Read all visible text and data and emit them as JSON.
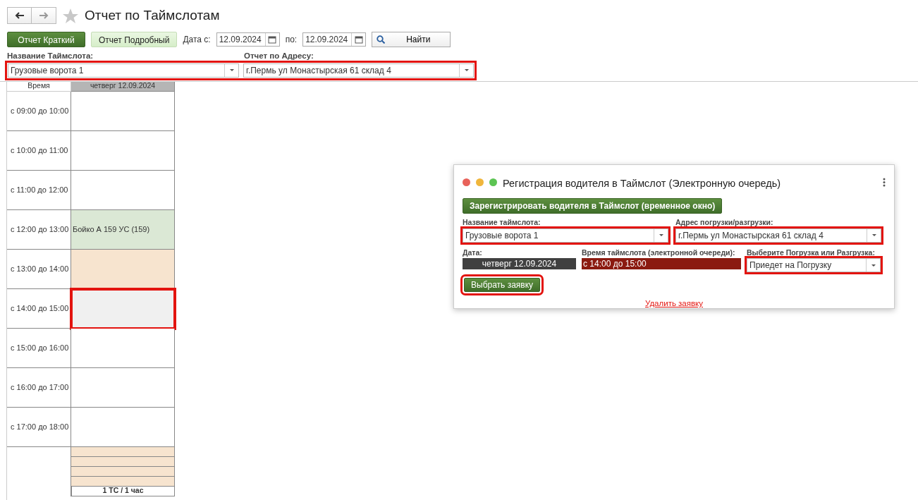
{
  "window": {
    "title": "Отчет по Таймслотам",
    "favorite": false
  },
  "toolbar": {
    "buttons": [
      {
        "label": "Отчет Краткий",
        "kind": "primary"
      },
      {
        "label": "Отчет Подробный",
        "kind": "light"
      }
    ],
    "date_from": {
      "label": "Дата с:",
      "value": "12.09.2024"
    },
    "date_to": {
      "label": "по:",
      "value": "12.09.2024"
    },
    "find_button": "Найти"
  },
  "filters": {
    "highlighted": true,
    "timeslot": {
      "label": "Название Таймслота:",
      "value": "Грузовые ворота 1"
    },
    "address": {
      "label": "Отчет по Адресу:",
      "value": "г.Пермь ул Монастырская 61 склад 4"
    }
  },
  "schedule": {
    "time_header": "Время",
    "day_header": "четверг 12.09.2024",
    "slots": [
      {
        "time": "с 09:00 до 10:00",
        "kind": "free",
        "highlighted": false
      },
      {
        "time": "с 10:00 до 11:00",
        "kind": "free",
        "highlighted": false
      },
      {
        "time": "с 11:00 до 12:00",
        "kind": "free",
        "highlighted": false
      },
      {
        "time": "с 12:00 до 13:00",
        "text": "Бойко А 159 УС (159)",
        "kind": "booked",
        "highlighted": false
      },
      {
        "time": "с 13:00 до 14:00",
        "kind": "reserved",
        "highlighted": false
      },
      {
        "time": "с 14:00 до 15:00",
        "kind": "selected",
        "highlighted": true
      },
      {
        "time": "с 15:00 до 16:00",
        "kind": "free",
        "highlighted": false
      },
      {
        "time": "с 16:00 до 17:00",
        "kind": "free",
        "highlighted": false
      },
      {
        "time": "с 17:00 до 18:00",
        "kind": "free",
        "highlighted": false
      }
    ],
    "bands": [
      {
        "kind": "reserved"
      },
      {
        "kind": "reserved"
      },
      {
        "kind": "reserved"
      },
      {
        "kind": "reserved"
      }
    ],
    "footer": "1 ТС / 1 час"
  },
  "dialog": {
    "title": "Регистрация водителя в Таймслот (Электронную очередь)",
    "register_button": "Зарегистрировать водителя в Таймслот (временное окно)",
    "timeslot": {
      "label": "Название таймслота:",
      "value": "Грузовые ворота 1",
      "highlighted": true
    },
    "address": {
      "label": "Адрес погрузки/разгрузки:",
      "value": "г.Пермь ул Монастырская 61 склад 4",
      "highlighted": true
    },
    "date": {
      "label": "Дата:",
      "value": "четверг 12.09.2024"
    },
    "time": {
      "label": "Время таймслота (электронной очереди):",
      "value": "с 14:00 до 15:00"
    },
    "operation": {
      "label": "Выберите Погрузка или Разгрузка:",
      "value": "Приедет на Погрузку",
      "highlighted": true
    },
    "choose_button": {
      "label": "Выбрать заявку",
      "highlighted": true
    },
    "delete_link": "Удалить заявку"
  }
}
